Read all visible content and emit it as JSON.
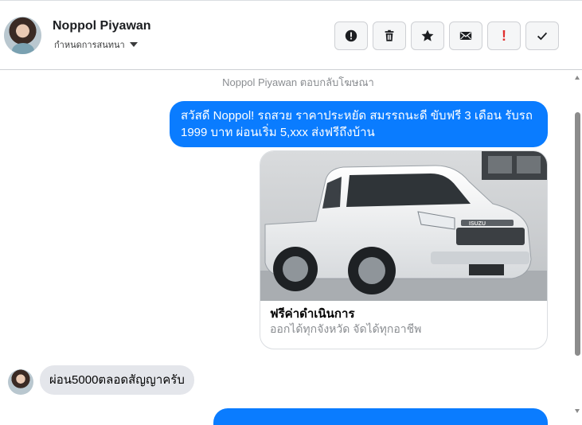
{
  "header": {
    "name": "Noppol Piyawan",
    "subtitle": "กำหนดการสนทนา",
    "toolbar": [
      {
        "icon": "report-icon"
      },
      {
        "icon": "trash-icon"
      },
      {
        "icon": "star-icon"
      },
      {
        "icon": "envelope-icon"
      },
      {
        "icon": "exclamation-icon",
        "label": "!"
      },
      {
        "icon": "checkmark-icon"
      }
    ]
  },
  "thread": {
    "notice": "Noppol Piyawan ตอบกลับโฆษณา",
    "outgoing_message": "สวัสดี Noppol! รถสวย ราคาประหยัด สมรรถนะดี ขับฟรี 3 เดือน รับรถ 1999 บาท ผ่อนเริ่ม 5,xxx ส่งฟรีถึงบ้าน",
    "ad_card": {
      "brand_badge": "ISUZU",
      "title": "ฟรีค่าดำเนินการ",
      "subtitle": "ออกได้ทุกจังหวัด จัดได้ทุกอาชีพ"
    },
    "incoming_message": "ผ่อน5000ตลอดสัญญาครับ"
  },
  "colors": {
    "outgoing_bubble": "#0a7cff",
    "incoming_bubble": "#e4e6eb",
    "danger": "#e02f2f"
  }
}
